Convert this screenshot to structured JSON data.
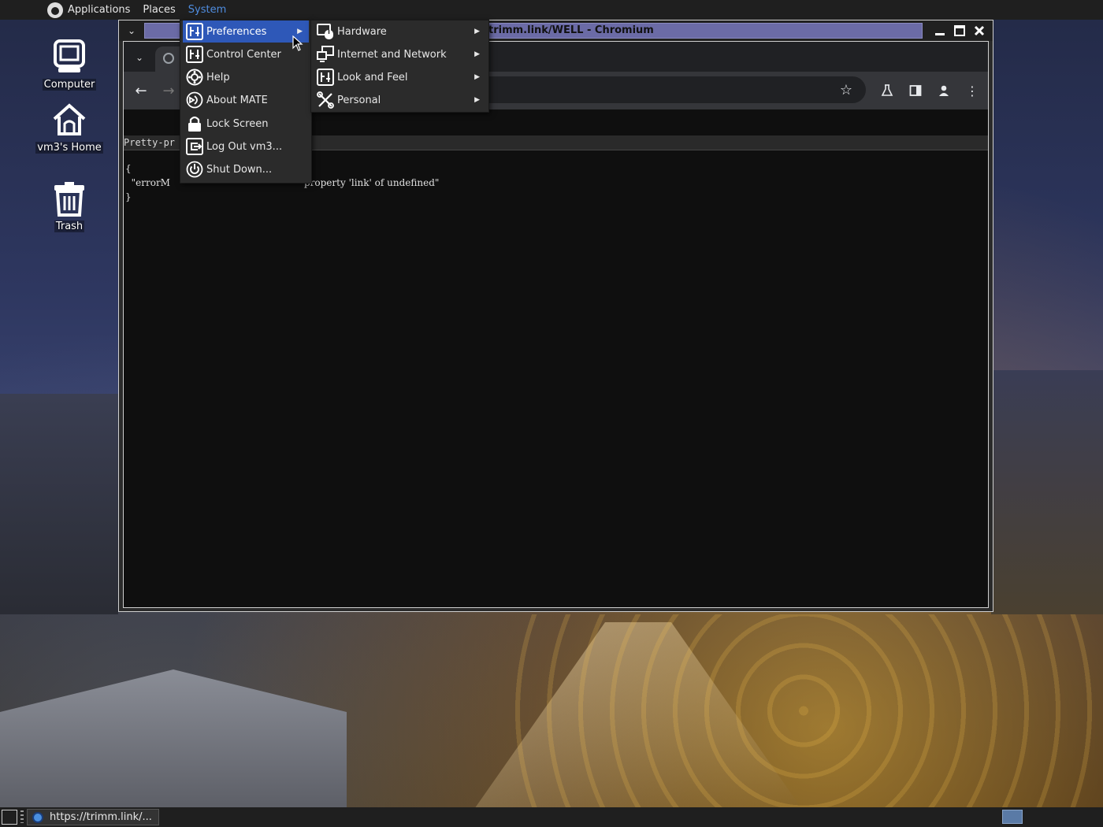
{
  "top_panel": {
    "menus": [
      "Applications",
      "Places",
      "System"
    ]
  },
  "desktop_icons": [
    {
      "label": "Computer",
      "icon": "computer-icon"
    },
    {
      "label": "vm3's Home",
      "icon": "home-folder-icon"
    },
    {
      "label": "Trash",
      "icon": "trash-icon"
    }
  ],
  "window": {
    "title": "trimm.link/WELL - Chromium"
  },
  "page": {
    "pretty_print_label": "Pretty-pr",
    "json_lines": [
      "{",
      "  \"errorM",
      "property 'link' of undefined\"",
      "}"
    ]
  },
  "system_menu": {
    "items": [
      {
        "label": "Preferences",
        "icon": "preferences-icon",
        "submenu": true,
        "highlighted": true
      },
      {
        "label": "Control Center",
        "icon": "control-center-icon"
      },
      {
        "label": "Help",
        "icon": "help-icon"
      },
      {
        "label": "About MATE",
        "icon": "about-icon"
      },
      {
        "label": "Lock Screen",
        "icon": "lock-icon"
      },
      {
        "label": "Log Out vm3...",
        "icon": "logout-icon"
      },
      {
        "label": "Shut Down...",
        "icon": "power-icon"
      }
    ]
  },
  "preferences_submenu": {
    "items": [
      {
        "label": "Hardware",
        "icon": "hardware-icon"
      },
      {
        "label": "Internet and Network",
        "icon": "network-icon"
      },
      {
        "label": "Look and Feel",
        "icon": "look-feel-icon"
      },
      {
        "label": "Personal",
        "icon": "personal-icon"
      }
    ]
  },
  "taskbar": {
    "task_label": "https://trimm.link/..."
  },
  "colors": {
    "menu_highlight": "#2e58b8",
    "title_field": "#6b6ba6",
    "active_menu": "#4f8de0"
  }
}
